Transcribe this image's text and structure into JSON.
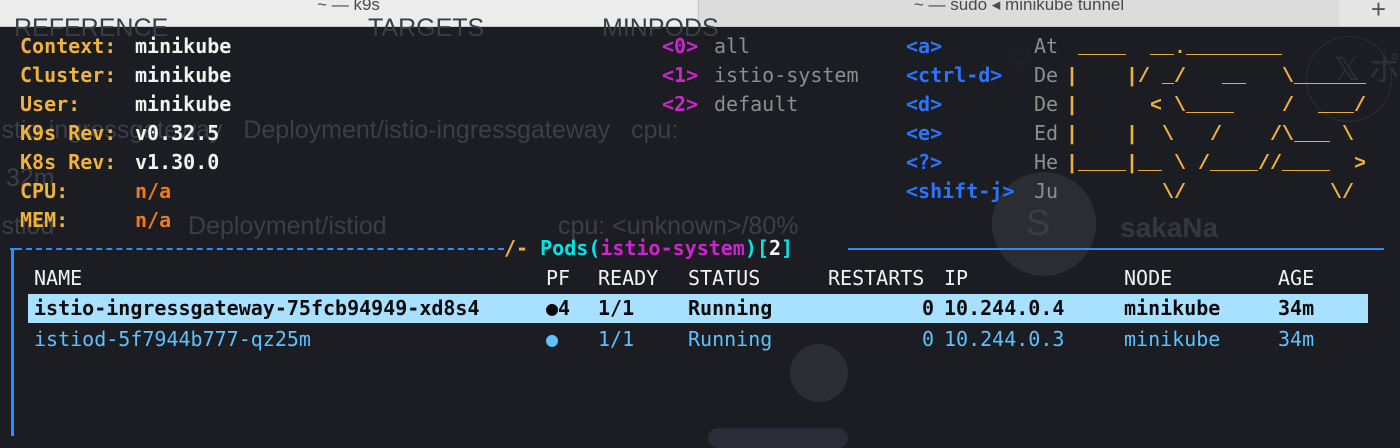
{
  "window": {
    "tabs": [
      {
        "label": "~ — k9s"
      },
      {
        "label": "~ — sudo ◂ minikube tunnel"
      }
    ],
    "new_tab_icon": "+"
  },
  "background": {
    "headers": [
      "REFERENCE",
      "TARGETS",
      "MINPODS"
    ],
    "lines": [
      "istio-ingressgateway",
      "Deployment/istio-ingressgateway",
      "cpu:",
      "32m",
      "istiod",
      "Deployment/istiod",
      "cpu: <unknown>/80%"
    ],
    "user_initial": "S",
    "user_name": "sakaNa",
    "x_label": "𝕏 ポ"
  },
  "header": {
    "info": [
      {
        "label": "Context:",
        "value": "minikube"
      },
      {
        "label": "Cluster:",
        "value": "minikube"
      },
      {
        "label": "User:",
        "value": "minikube"
      },
      {
        "label": "K9s Rev:",
        "value": "v0.32.5"
      },
      {
        "label": "K8s Rev:",
        "value": "v1.30.0"
      },
      {
        "label": "CPU:",
        "value": "n/a"
      },
      {
        "label": "MEM:",
        "value": "n/a"
      }
    ],
    "namespaces": [
      {
        "key": "<0>",
        "name": "all"
      },
      {
        "key": "<1>",
        "name": "istio-system"
      },
      {
        "key": "<2>",
        "name": "default"
      }
    ],
    "hints": [
      {
        "key": "<a>",
        "desc": "At"
      },
      {
        "key": "<ctrl-d>",
        "desc": "De"
      },
      {
        "key": "<d>",
        "desc": "De"
      },
      {
        "key": "<e>",
        "desc": "Ed"
      },
      {
        "key": "<?>",
        "desc": "He"
      },
      {
        "key": "<shift-j>",
        "desc": "Ju"
      }
    ],
    "logo_text": " ____  __.________\n|    |/ _/   __   \\______\n|      < \\____    /  ___/\n|    |  \\   /    /\\___ \\\n|____|__ \\ /____//____  >\n        \\/            \\/"
  },
  "table": {
    "title_word": "Pods",
    "namespace": "istio-system",
    "count": "2",
    "columns": [
      "NAME",
      "PF",
      "READY",
      "STATUS",
      "RESTARTS",
      "IP",
      "NODE",
      "AGE"
    ],
    "rows": [
      {
        "name": "istio-ingressgateway-75fcb94949-xd8s4",
        "pf": "●4",
        "ready": "1/1",
        "status": "Running",
        "restarts": "0",
        "ip": "10.244.0.4",
        "node": "minikube",
        "age": "34m",
        "selected": true
      },
      {
        "name": "istiod-5f7944b777-qz25m",
        "pf": "●",
        "ready": "1/1",
        "status": "Running",
        "restarts": "0",
        "ip": "10.244.0.3",
        "node": "minikube",
        "age": "34m",
        "selected": false
      }
    ]
  },
  "colors": {
    "background": "#1b1d22",
    "label_yellow": "#f0b23c",
    "value_orange": "#f07a1a",
    "magenta": "#d023d0",
    "hint_blue": "#2b74ff",
    "border_blue": "#2f8cff",
    "title_cyan": "#00e5e5",
    "row_cyan": "#5ec2ff",
    "selection_bg": "#a8e0ff"
  }
}
